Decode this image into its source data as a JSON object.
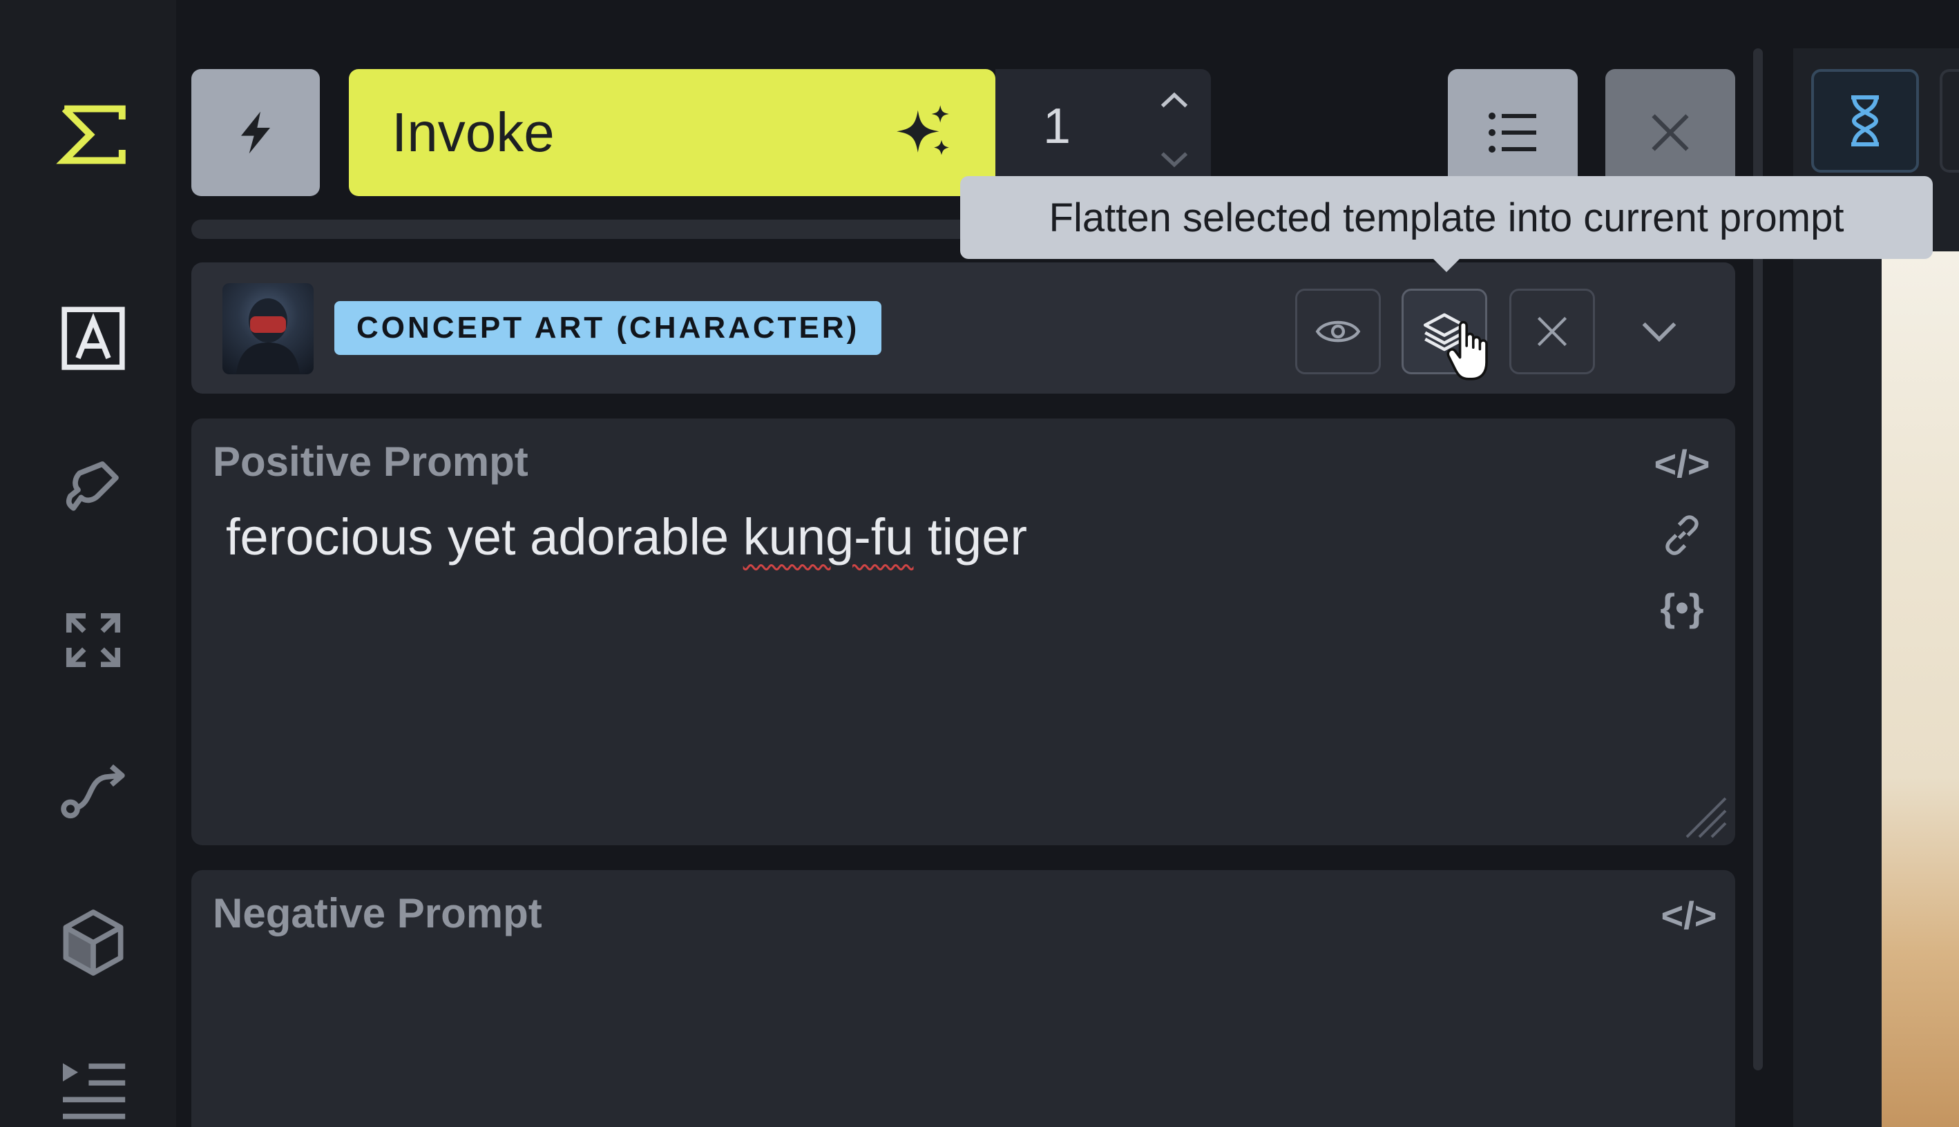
{
  "toolbar": {
    "invoke_label": "Invoke",
    "iterations_value": "1"
  },
  "tooltip": {
    "text": "Flatten selected template into current prompt"
  },
  "template": {
    "badge_label": "CONCEPT ART (CHARACTER)"
  },
  "positive_prompt": {
    "label": "Positive Prompt",
    "text_before": "ferocious yet adorable ",
    "text_misspelled": "kung-fu",
    "text_after": " tiger"
  },
  "negative_prompt": {
    "label": "Negative Prompt"
  },
  "prompt_tools": {
    "code_symbol": "</>",
    "dynamic_symbol": "{•}"
  },
  "colors": {
    "accent": "#e1ec52",
    "badge": "#90cdf4",
    "tooltip_bg": "#c6cbd3"
  },
  "icons": [
    "invoke-logo-icon",
    "text-box-icon",
    "brush-icon",
    "expand-icon",
    "workflow-icon",
    "cube-icon",
    "queue-list-icon",
    "lightning-icon",
    "sparkles-icon",
    "chevron-up-icon",
    "chevron-down-icon",
    "list-icon",
    "close-icon",
    "eye-icon",
    "flatten-layers-icon",
    "chevron-down-icon",
    "code-icon",
    "link-icon",
    "hourglass-icon"
  ]
}
